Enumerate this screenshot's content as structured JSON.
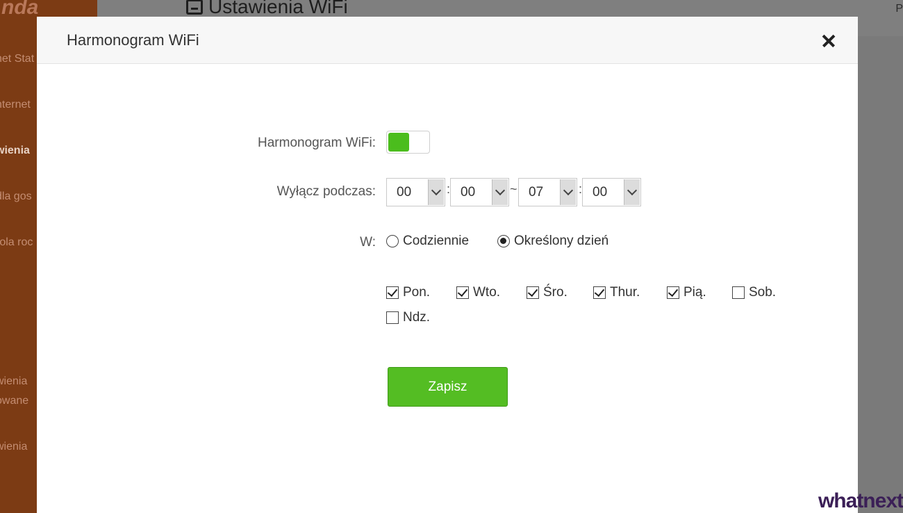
{
  "background": {
    "logo": "nda",
    "nav_items": [
      "net Stat",
      "nternet",
      "wienia",
      "dla gos",
      "rola roc",
      "wienia",
      "owane",
      "wienia"
    ],
    "page_title": "Ustawienia WiFi",
    "header_right": "P"
  },
  "modal": {
    "title": "Harmonogram WiFi",
    "schedule_label": "Harmonogram WiFi:",
    "schedule_enabled": true,
    "off_during_label": "Wyłącz podczas:",
    "start_hour": "00",
    "start_minute": "00",
    "range_separator": "~",
    "time_separator": ":",
    "end_hour": "07",
    "end_minute": "00",
    "on_label": "W:",
    "radio_daily": "Codziennie",
    "radio_specific": "Określony dzień",
    "selected_mode": "specific",
    "days": [
      {
        "label": "Pon.",
        "checked": true
      },
      {
        "label": "Wto.",
        "checked": true
      },
      {
        "label": "Śro.",
        "checked": true
      },
      {
        "label": "Thur.",
        "checked": true
      },
      {
        "label": "Pią.",
        "checked": true
      },
      {
        "label": "Sob.",
        "checked": false
      },
      {
        "label": "Ndz.",
        "checked": false
      }
    ],
    "save_label": "Zapisz"
  },
  "watermark": "whatnext",
  "colors": {
    "accent_green": "#54bd23",
    "sidebar_brown": "#7c3b14"
  }
}
